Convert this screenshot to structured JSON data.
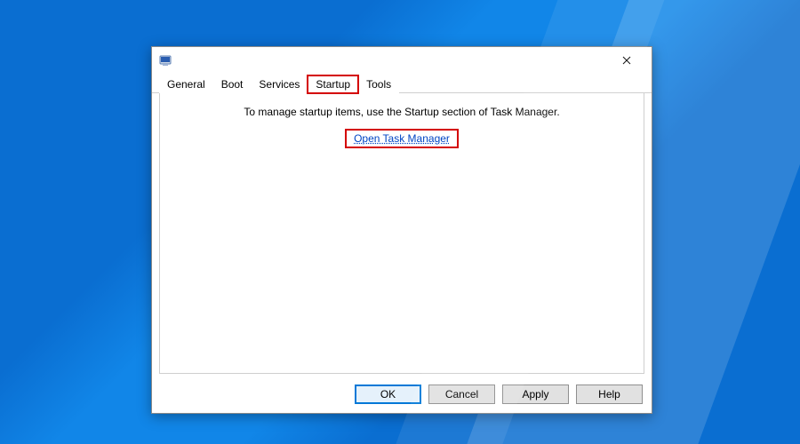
{
  "window": {
    "title": ""
  },
  "tabs": {
    "general": "General",
    "boot": "Boot",
    "services": "Services",
    "startup": "Startup",
    "tools": "Tools",
    "active": "startup"
  },
  "startup_panel": {
    "info": "To manage startup items, use the Startup section of Task Manager.",
    "link": "Open Task Manager"
  },
  "buttons": {
    "ok": "OK",
    "cancel": "Cancel",
    "apply": "Apply",
    "help": "Help"
  },
  "colors": {
    "highlight": "#d40000",
    "accent": "#0078d7",
    "link": "#0045c4"
  }
}
